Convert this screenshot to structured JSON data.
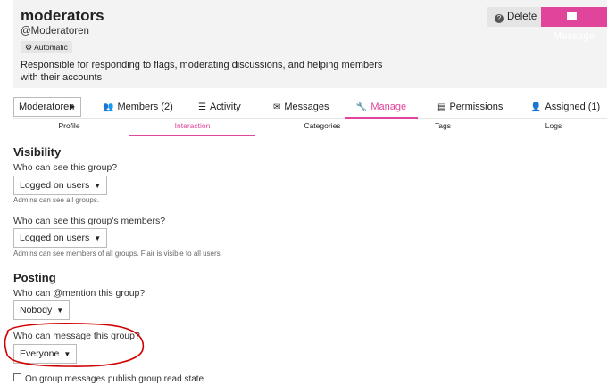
{
  "group": {
    "name": "moderators",
    "handle": "@Moderatoren",
    "badge": "Automatic",
    "description": "Responsible for responding to flags, moderating discussions, and helping members with their accounts",
    "delete_label": "Delete",
    "message_label": "Message"
  },
  "nav": {
    "selector": "Moderatoren",
    "tabs": [
      {
        "label": "Members (2)",
        "icon": "users-icon"
      },
      {
        "label": "Activity",
        "icon": "list-icon"
      },
      {
        "label": "Messages",
        "icon": "envelope-icon"
      },
      {
        "label": "Manage",
        "icon": "wrench-icon"
      },
      {
        "label": "Permissions",
        "icon": "id-card-icon"
      },
      {
        "label": "Assigned (1)",
        "icon": "user-plus-icon"
      }
    ],
    "subtabs": [
      "Profile",
      "Interaction",
      "Categories",
      "Tags",
      "Logs"
    ]
  },
  "visibility": {
    "heading": "Visibility",
    "see_group_label": "Who can see this group?",
    "see_group_value": "Logged on users",
    "see_group_help": "Admins can see all groups.",
    "see_members_label": "Who can see this group's members?",
    "see_members_value": "Logged on users",
    "see_members_help": "Admins can see members of all groups. Flair is visible to all users."
  },
  "posting": {
    "heading": "Posting",
    "mention_label": "Who can @mention this group?",
    "mention_value": "Nobody",
    "message_label": "Who can message this group?",
    "message_value": "Everyone",
    "read_state_label": "On group messages publish group read state"
  },
  "colors": {
    "accent": "#e0459b",
    "annotation": "#d10000"
  }
}
